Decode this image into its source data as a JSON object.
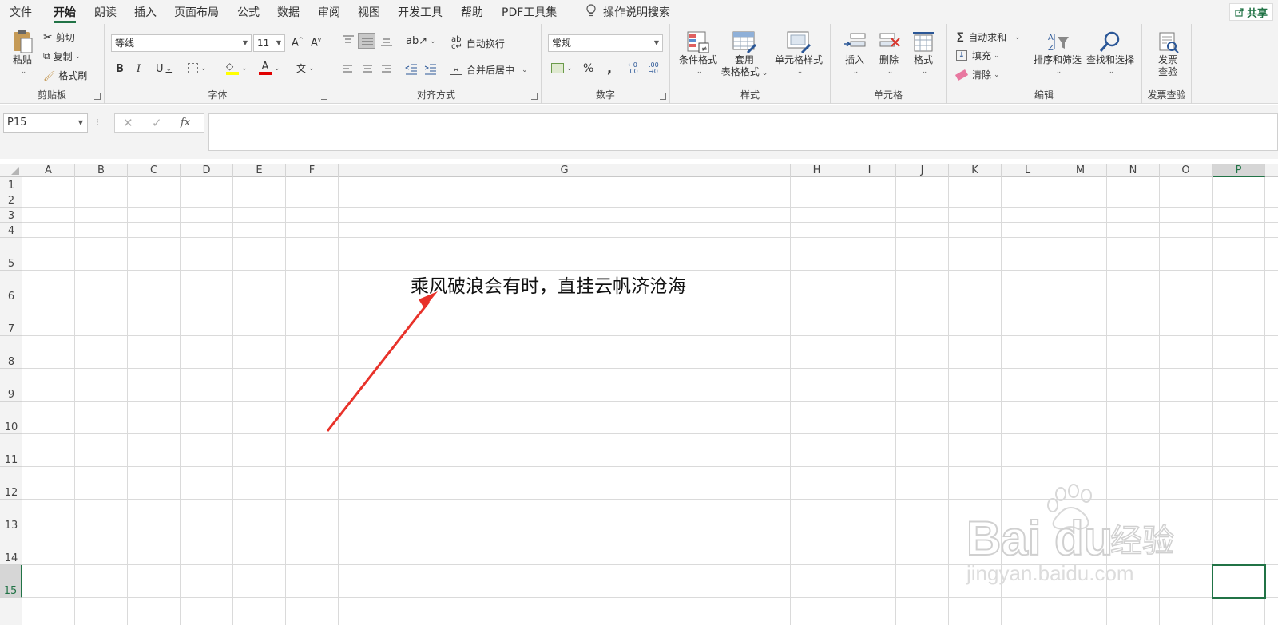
{
  "menu": {
    "items": [
      "文件",
      "开始",
      "朗读",
      "插入",
      "页面布局",
      "公式",
      "数据",
      "审阅",
      "视图",
      "开发工具",
      "帮助",
      "PDF工具集"
    ],
    "active": "开始",
    "search_label": "操作说明搜索",
    "share_label": "共享"
  },
  "ribbon": {
    "clipboard": {
      "label": "剪贴板",
      "paste": "粘贴",
      "cut": "剪切",
      "copy": "复制",
      "format_painter": "格式刷"
    },
    "font": {
      "label": "字体",
      "font_name": "等线",
      "font_size": "11",
      "bold": "B",
      "italic": "I",
      "underline": "U"
    },
    "alignment": {
      "label": "对齐方式",
      "wrap_text": "自动换行",
      "merge_center": "合并后居中"
    },
    "number": {
      "label": "数字",
      "format": "常规",
      "percent": "%",
      "comma": ","
    },
    "styles": {
      "label": "样式",
      "conditional": "条件格式",
      "table_format_1": "套用",
      "table_format_2": "表格格式",
      "cell_styles": "单元格样式"
    },
    "cells": {
      "label": "单元格",
      "insert": "插入",
      "delete": "删除",
      "format": "格式"
    },
    "editing": {
      "label": "编辑",
      "autosum": "自动求和",
      "fill": "填充",
      "clear": "清除",
      "sort_filter": "排序和筛选",
      "find_select": "查找和选择"
    },
    "invoice": {
      "label": "发票查验",
      "btn_line1": "发票",
      "btn_line2": "查验"
    }
  },
  "formula_bar": {
    "name_box": "P15",
    "fx": "fx",
    "content": ""
  },
  "sheet": {
    "columns": [
      "A",
      "B",
      "C",
      "D",
      "E",
      "F",
      "G",
      "H",
      "I",
      "J",
      "K",
      "L",
      "M",
      "N",
      "O",
      "P"
    ],
    "rows": [
      "1",
      "2",
      "3",
      "4",
      "5",
      "6",
      "7",
      "8",
      "9",
      "10",
      "11",
      "12",
      "13",
      "14",
      "15"
    ],
    "selected_cell": "P15",
    "cell_G6": "乘风破浪会有时，直挂云帆济沧海"
  },
  "watermark": {
    "brand": "Bai",
    "brand2": "du",
    "suffix": "经验",
    "url": "jingyan.baidu.com"
  },
  "colors": {
    "accent": "#217346",
    "arrow": "#e8322a"
  }
}
